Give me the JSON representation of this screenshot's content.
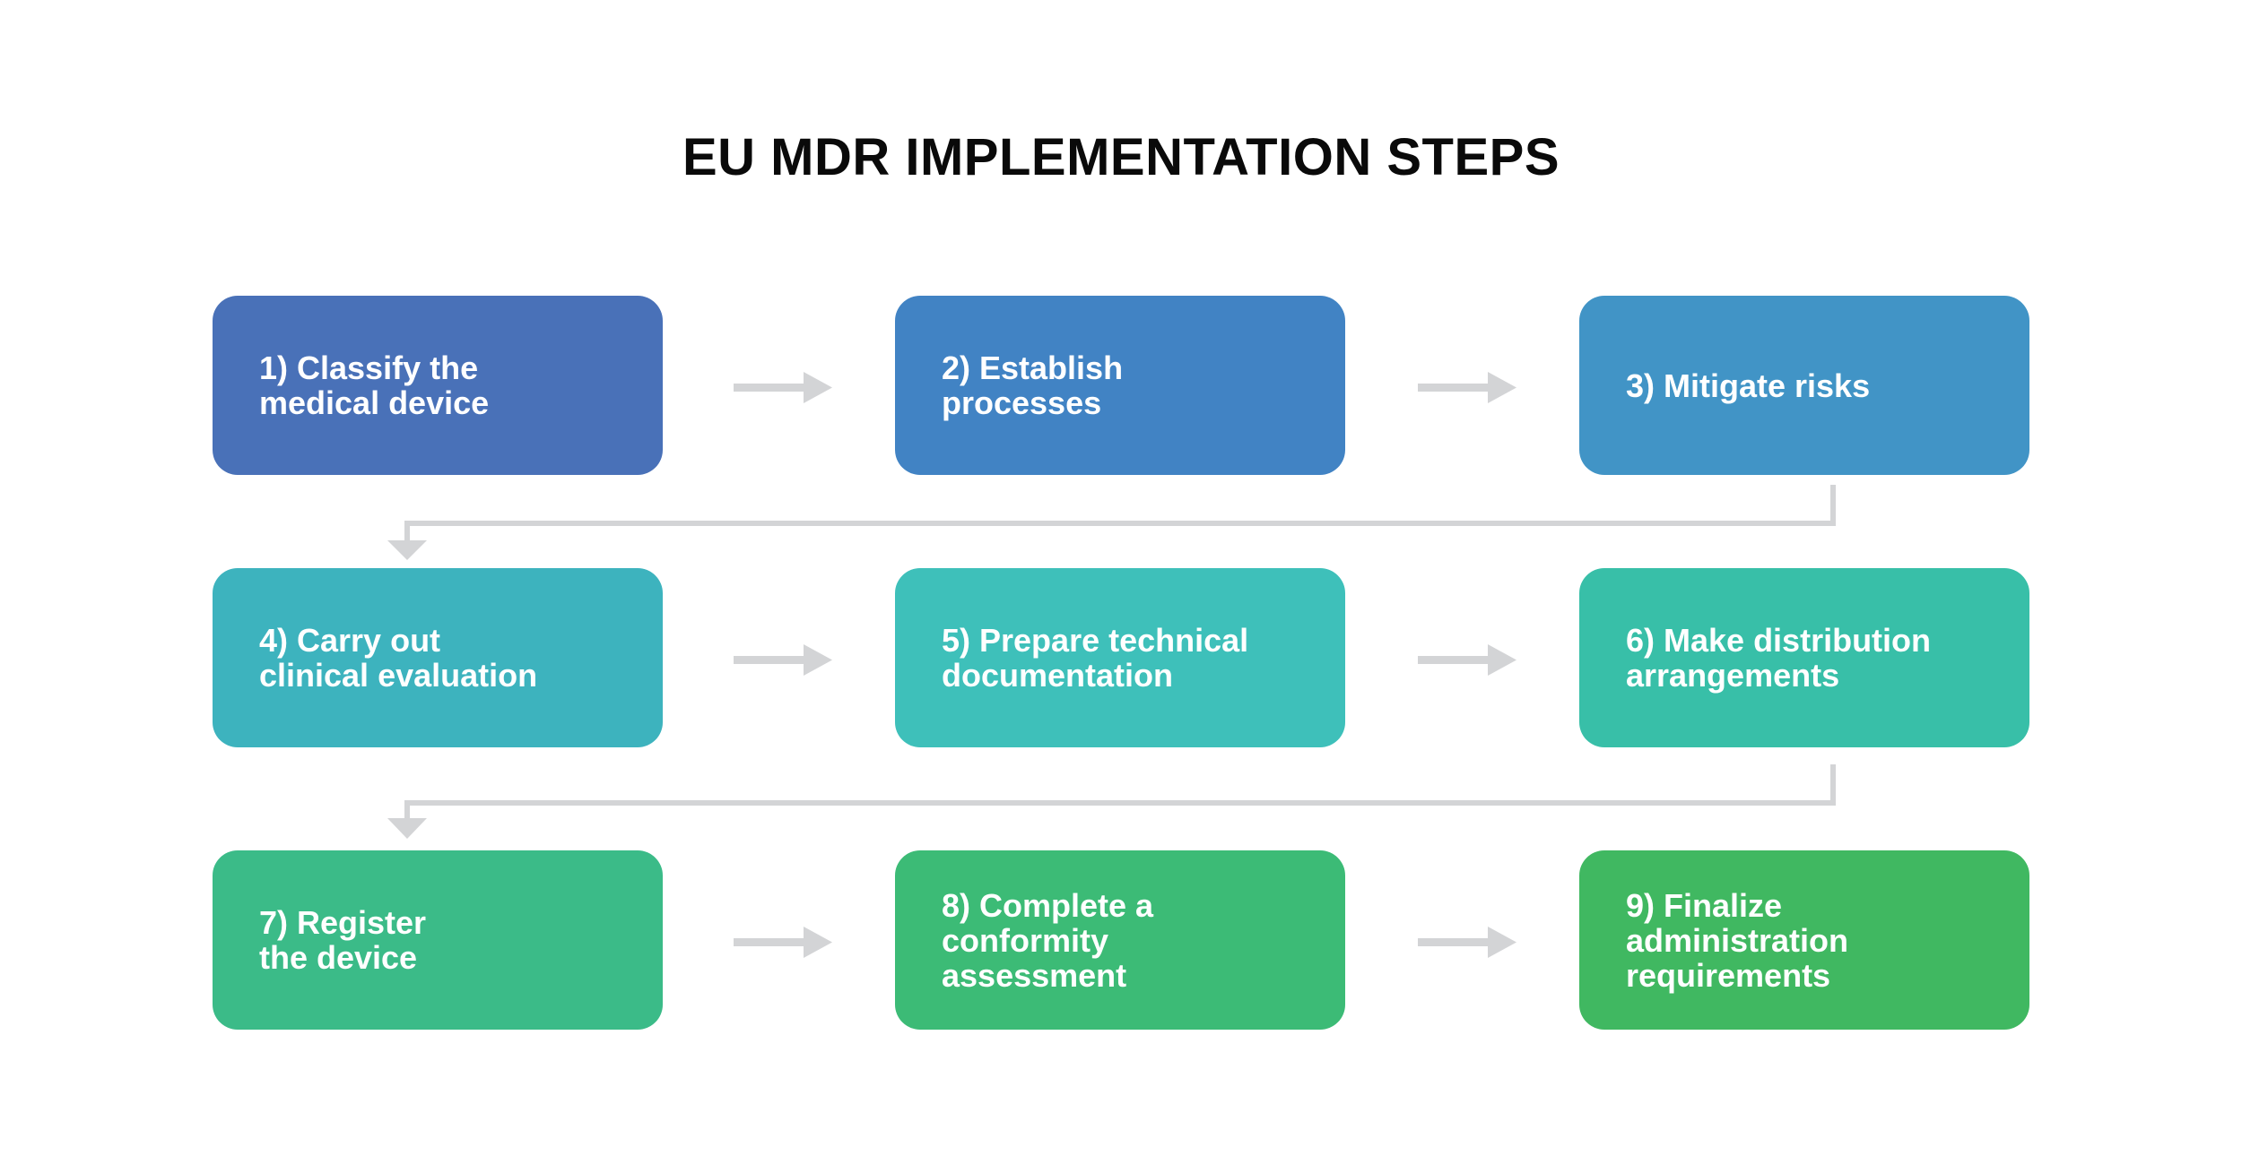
{
  "title": "EU MDR IMPLEMENTATION STEPS",
  "steps": [
    {
      "number": "1)",
      "label": "1) Classify the\nmedical device",
      "color": "#4971b8"
    },
    {
      "number": "2)",
      "label": "2) Establish\nprocesses",
      "color": "#4183c4"
    },
    {
      "number": "3)",
      "label": "3) Mitigate risks",
      "color": "#4194c6"
    },
    {
      "number": "4)",
      "label": "4) Carry out\nclinical evaluation",
      "color": "#3db3be"
    },
    {
      "number": "5)",
      "label": "5) Prepare technical\ndocumentation",
      "color": "#3ec0ba"
    },
    {
      "number": "6)",
      "label": "6) Make distribution\narrangements",
      "color": "#38bfa8"
    },
    {
      "number": "7)",
      "label": "7) Register\nthe device",
      "color": "#3bbb88"
    },
    {
      "number": "8)",
      "label": "8) Complete a\nconformity\nassessment",
      "color": "#3cbb76"
    },
    {
      "number": "9)",
      "label": "9) Finalize\nadministration\nrequirements",
      "color": "#40b861"
    }
  ],
  "connector_color": "#d3d4d6",
  "flow": [
    {
      "from": 1,
      "to": 2,
      "type": "right-arrow"
    },
    {
      "from": 2,
      "to": 3,
      "type": "right-arrow"
    },
    {
      "from": 3,
      "to": 4,
      "type": "elbow-down-arrow"
    },
    {
      "from": 4,
      "to": 5,
      "type": "right-arrow"
    },
    {
      "from": 5,
      "to": 6,
      "type": "right-arrow"
    },
    {
      "from": 6,
      "to": 7,
      "type": "elbow-down-arrow"
    },
    {
      "from": 7,
      "to": 8,
      "type": "right-arrow"
    },
    {
      "from": 8,
      "to": 9,
      "type": "right-arrow"
    }
  ]
}
